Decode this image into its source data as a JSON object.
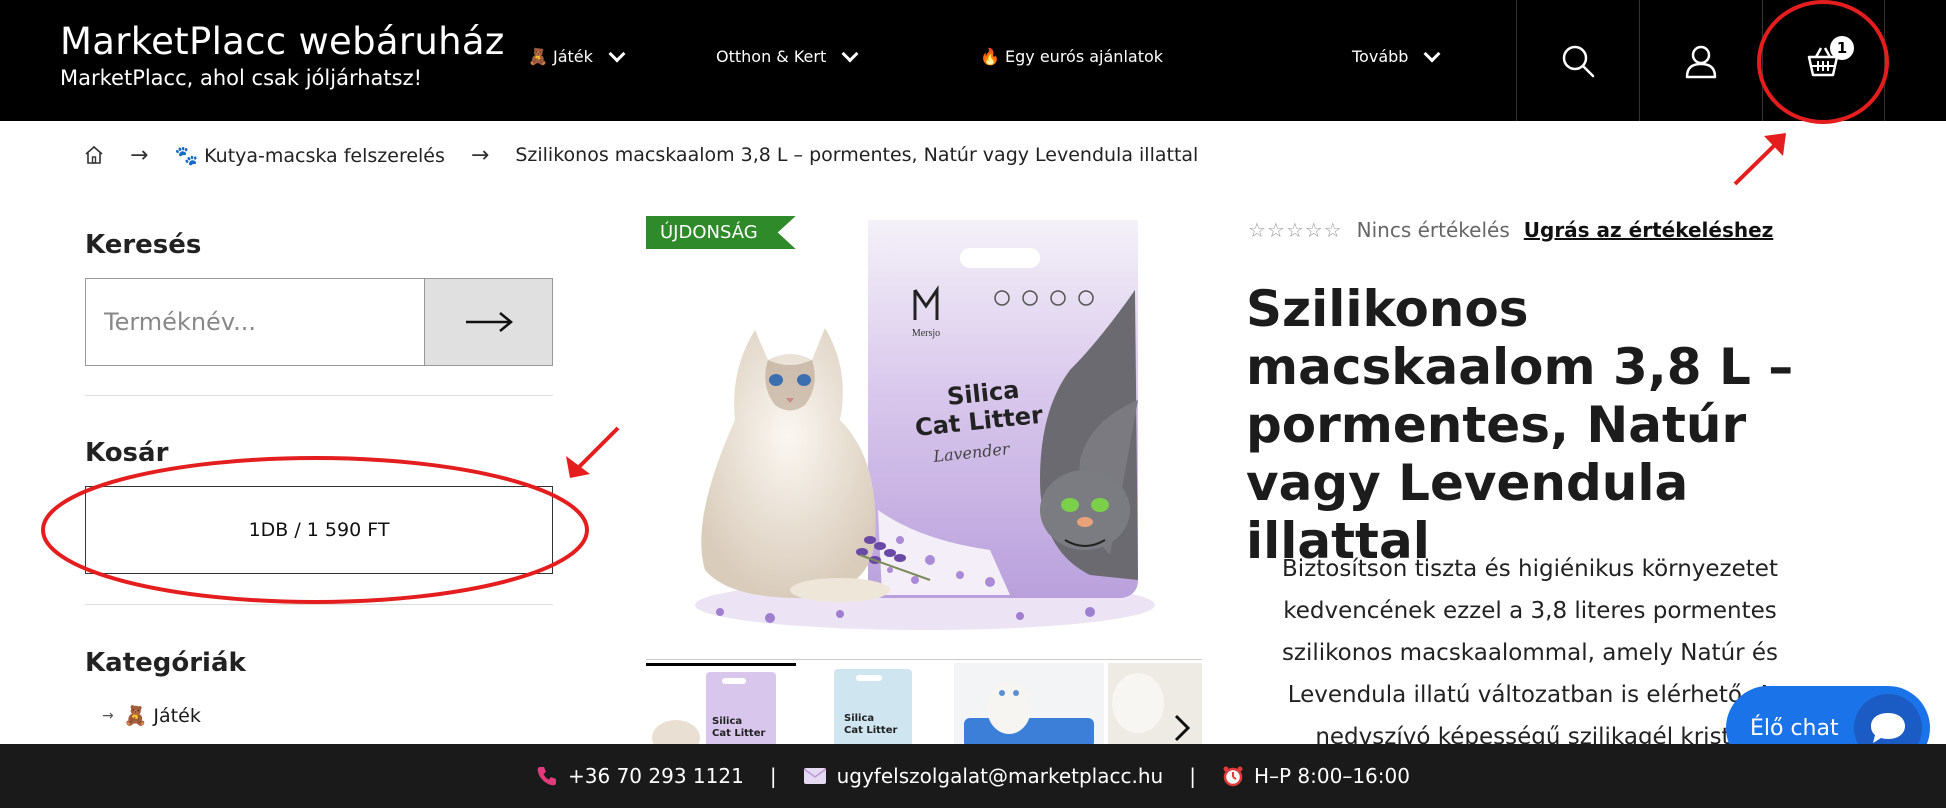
{
  "header": {
    "brand_title": "MarketPlacc webáruház",
    "brand_tagline": "MarketPlacc, ahol csak jóljárhatsz!",
    "nav": [
      {
        "label": "🧸 Játék",
        "has_dropdown": true
      },
      {
        "label": "Otthon & Kert",
        "has_dropdown": true
      },
      {
        "label": "🔥 Egy eurós ajánlatok",
        "has_dropdown": false
      },
      {
        "label": "Tovább",
        "has_dropdown": true
      }
    ],
    "cart_count": "1",
    "icons": [
      "search-icon",
      "user-icon",
      "basket-icon"
    ]
  },
  "breadcrumb": {
    "home_icon": "home-icon",
    "items": [
      "🐾 Kutya-macska felszerelés",
      "Szilikonos macskaalom 3,8 L – pormentes, Natúr vagy Levendula illattal"
    ],
    "separator": "→"
  },
  "sidebar": {
    "search_heading": "Keresés",
    "search_placeholder": "Terméknév...",
    "cart_heading": "Kosár",
    "cart_summary": "1DB / 1 590 FT",
    "categories_heading": "Kategóriák",
    "categories": [
      {
        "label": "🧸 Játék"
      }
    ]
  },
  "product": {
    "badge": "ÚJDONSÁG",
    "rating_text": "Nincs értékelés",
    "rating_link": "Ugrás az értékeléshez",
    "stars": "☆☆☆☆☆",
    "title": "Szilikonos macskaalom 3,8 L – pormentes, Natúr vagy Levendula illattal",
    "description": "Biztosítson tiszta és higiénikus környezetet kedvencének ezzel a 3,8 literes pormentes szilikonos macskaalommal, amely Natúr és Levendula illatú változatban is elérhető. A nedvszívó képességű szilikagél kristá",
    "package_text": {
      "brand": "Mersjo",
      "line1": "Silica",
      "line2": "Cat Litter",
      "line3": "Lavender"
    }
  },
  "chat": {
    "label": "Élő chat"
  },
  "footer": {
    "phone": "+36 70 293 1121",
    "email": "ugyfelszolgalat@marketplacc.hu",
    "hours": "H–P 8:00–16:00",
    "separator": "|"
  },
  "colors": {
    "header_bg": "#000000",
    "badge_green": "#2f8a2a",
    "annotation_red": "#e41e1e",
    "chat_blue": "#1a73e8"
  }
}
